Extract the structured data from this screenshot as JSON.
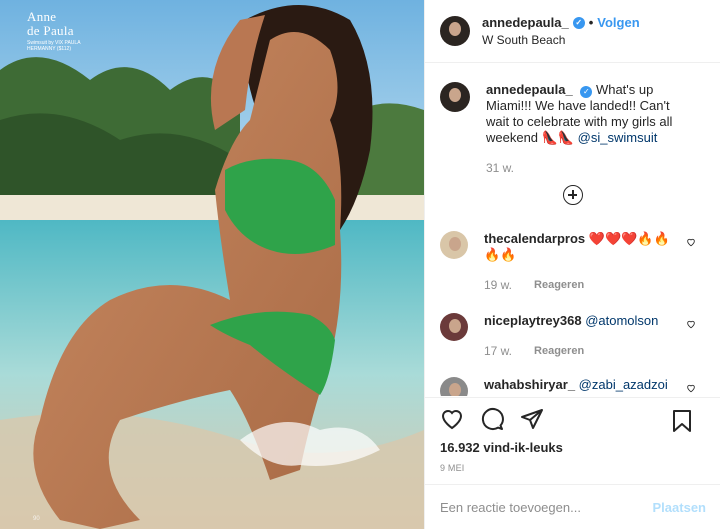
{
  "photo": {
    "magazine_name_1": "Anne",
    "magazine_name_2": "de Paula",
    "credit": "Swimsuit by VIX PAULA HERMANNY ($112)",
    "page_number": "90"
  },
  "header": {
    "username": "annedepaula_",
    "follow_label": "Volgen",
    "location": "W South Beach"
  },
  "caption": {
    "username": "annedepaula_",
    "text": "What's up Miami!!! We have landed!! Can't wait to celebrate with my girls all weekend",
    "emojis": "👠👠",
    "mention": "@si_swimsuit",
    "time": "31 w."
  },
  "comments": [
    {
      "username": "thecalendarpros",
      "text": "❤️❤️❤️🔥🔥🔥🔥",
      "time": "19 w.",
      "reply": "Reageren"
    },
    {
      "username": "niceplaytrey368",
      "text": "@atomolson",
      "time": "17 w.",
      "reply": "Reageren"
    },
    {
      "username": "wahabshiryar_",
      "text": "@zabi_azadzoi",
      "time": "",
      "reply": ""
    }
  ],
  "actions": {
    "likes": "16.932 vind-ik-leuks",
    "date": "9 MEI"
  },
  "add_comment": {
    "placeholder": "Een reactie toevoegen...",
    "post_label": "Plaatsen"
  },
  "colors": {
    "accent": "#3897f0",
    "post_disabled": "#b2dffc",
    "muted": "#8e8e8e"
  },
  "icons": [
    "verified-badge-icon",
    "add-more-comments-icon",
    "heart-icon",
    "comment-icon",
    "share-icon",
    "bookmark-icon"
  ]
}
